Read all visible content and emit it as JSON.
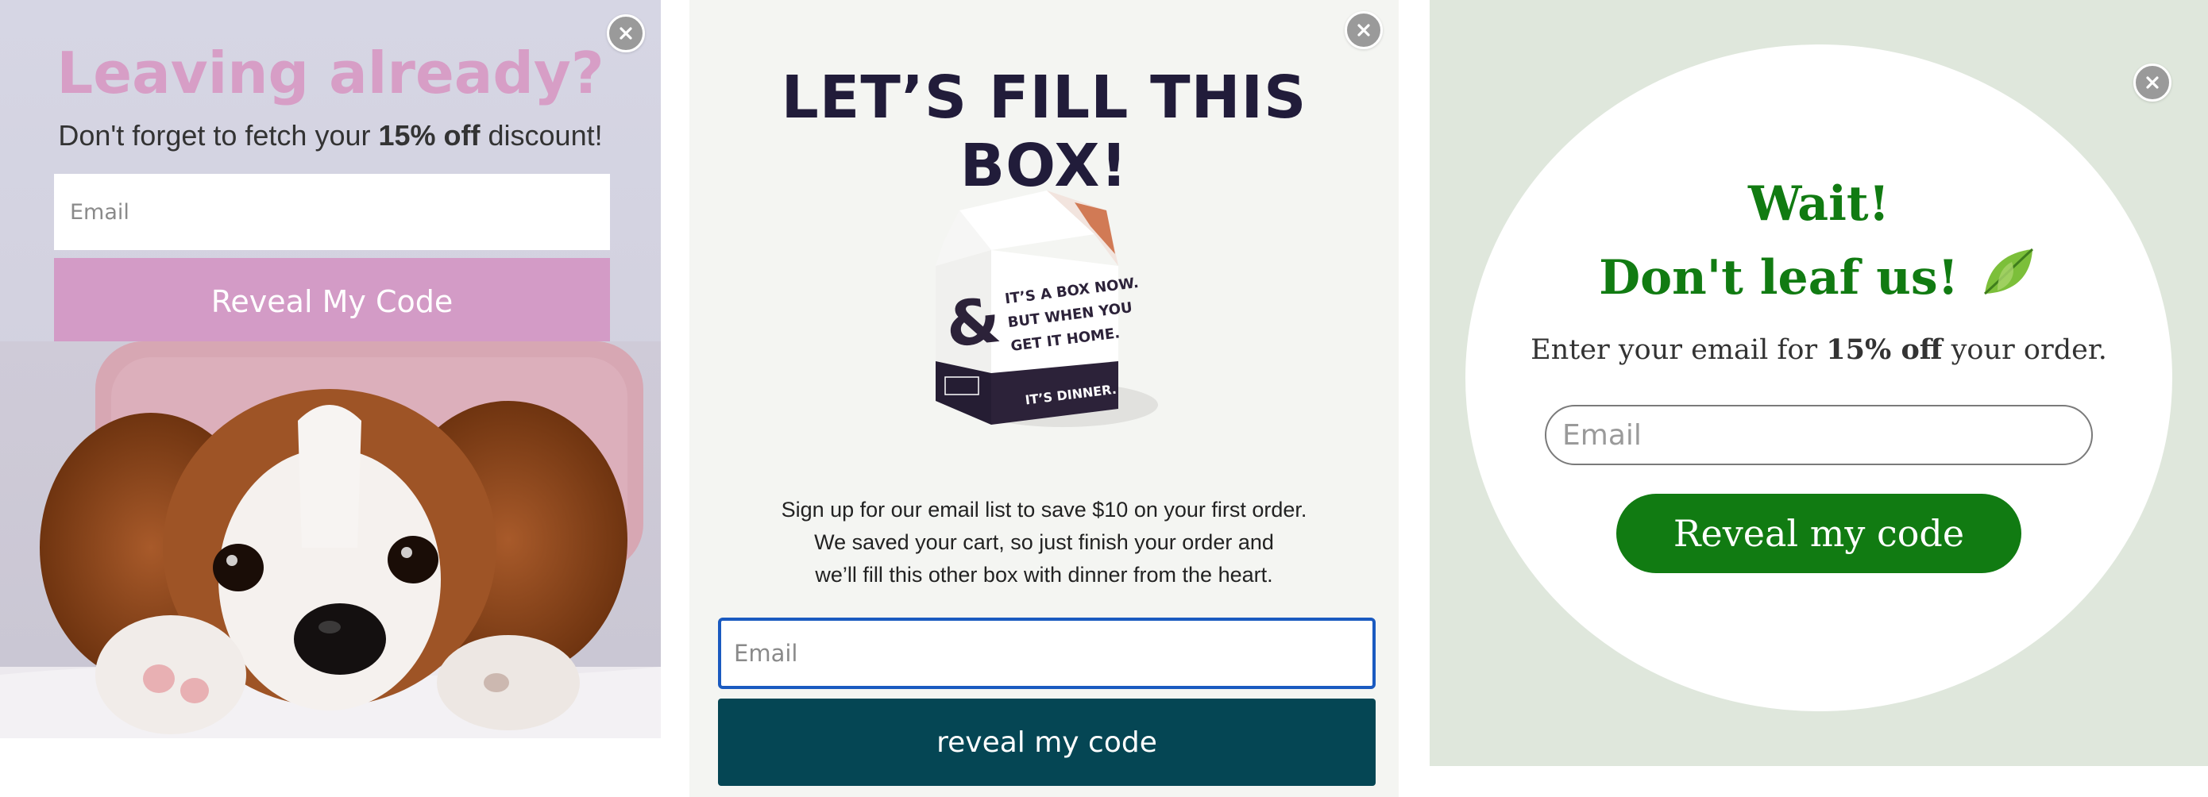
{
  "popup1": {
    "title": "Leaving already?",
    "subtitle_before": "Don't forget to fetch your ",
    "subtitle_bold": "15% off",
    "subtitle_after": " discount!",
    "email_placeholder": "Email",
    "cta_label": "Reveal My Code",
    "image": "puppy-photo",
    "colors": {
      "accent": "#d39bc6",
      "title": "#d79ec6"
    }
  },
  "popup2": {
    "title": "LET’S FILL THIS BOX!",
    "box_text": [
      "IT’S A BOX NOW.",
      "BUT WHEN YOU",
      "GET IT HOME.",
      "IT’S DINNER."
    ],
    "body_lines": [
      "Sign up for our email list to save $10 on your first order.",
      "We saved your cart, so just finish your order and",
      "we’ll fill this other box with dinner from the heart."
    ],
    "email_placeholder": "Email",
    "cta_label": "reveal my code",
    "colors": {
      "accent": "#054654",
      "title": "#211c3a",
      "focus": "#1a5ac0"
    }
  },
  "popup3": {
    "title_line1": "Wait!",
    "title_line2": "Don't leaf us!",
    "body_before": "Enter your email for ",
    "body_bold": "15% off",
    "body_after": " your order.",
    "email_placeholder": "Email",
    "cta_label": "Reveal my code",
    "colors": {
      "accent": "#117b12",
      "background": "#dfe7dc"
    }
  },
  "icons": {
    "close": "close-icon",
    "leaf": "leaf-icon"
  }
}
